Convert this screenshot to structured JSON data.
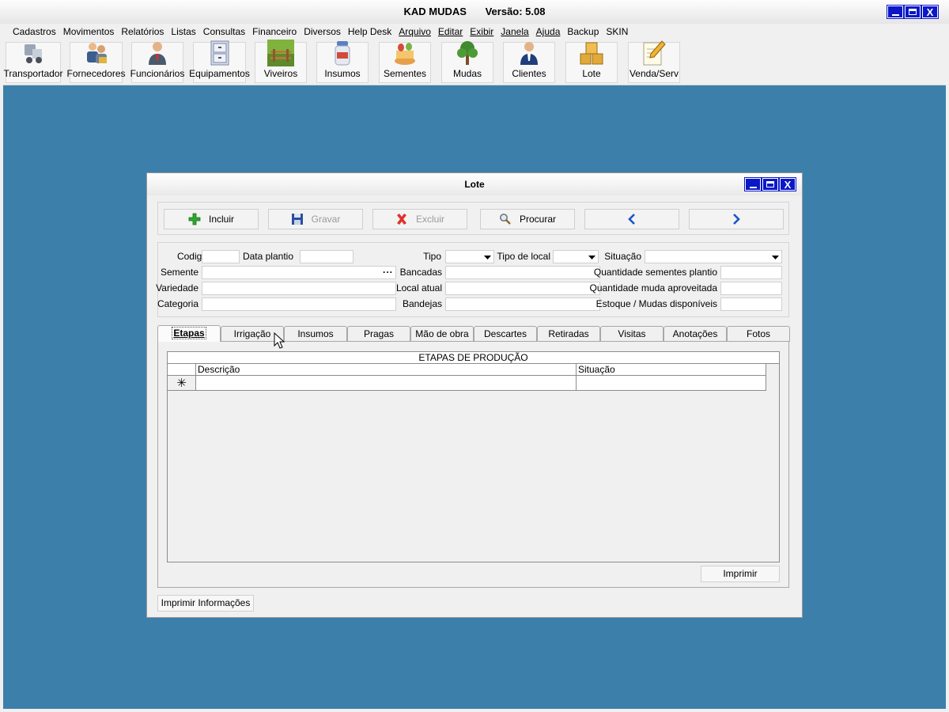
{
  "app": {
    "title": "KAD MUDAS",
    "version": "Versão: 5.08",
    "window_buttons": {
      "minimize": "minimize",
      "maximize": "maximize",
      "close": "X"
    }
  },
  "menu": [
    {
      "label": "Cadastros",
      "underline": false
    },
    {
      "label": "Movimentos",
      "underline": false
    },
    {
      "label": "Relatórios",
      "underline": false
    },
    {
      "label": "Listas",
      "underline": false
    },
    {
      "label": "Consultas",
      "underline": false
    },
    {
      "label": "Financeiro",
      "underline": false
    },
    {
      "label": "Diversos",
      "underline": false
    },
    {
      "label": "Help Desk",
      "underline": false
    },
    {
      "label": "Arquivo",
      "underline": true
    },
    {
      "label": "Editar",
      "underline": true
    },
    {
      "label": "Exibir",
      "underline": true
    },
    {
      "label": "Janela",
      "underline": true
    },
    {
      "label": "Ajuda",
      "underline": true
    },
    {
      "label": "Backup",
      "underline": false
    },
    {
      "label": "SKIN",
      "underline": false
    }
  ],
  "toolbar": [
    {
      "label": "Transportador",
      "icon": "truck-icon"
    },
    {
      "label": "Fornecedores",
      "icon": "suppliers-icon"
    },
    {
      "label": "Funcionários",
      "icon": "employee-icon"
    },
    {
      "label": "Equipamentos",
      "icon": "cabinet-icon"
    },
    {
      "label": "Viveiros",
      "icon": "nursery-icon"
    },
    {
      "label": "Insumos",
      "icon": "jar-icon"
    },
    {
      "label": "Sementes",
      "icon": "seeds-icon"
    },
    {
      "label": "Mudas",
      "icon": "tree-icon"
    },
    {
      "label": "Clientes",
      "icon": "client-icon"
    },
    {
      "label": "Lote",
      "icon": "boxes-icon"
    },
    {
      "label": "Venda/Serv",
      "icon": "pencil-note-icon"
    }
  ],
  "lote": {
    "title": "Lote",
    "actions": {
      "incluir": "Incluir",
      "gravar": "Gravar",
      "excluir": "Excluir",
      "procurar": "Procurar"
    },
    "form": {
      "codigo": {
        "label": "Codigo",
        "value": ""
      },
      "data_plantio": {
        "label": "Data plantio",
        "value": ""
      },
      "tipo": {
        "label": "Tipo",
        "value": ""
      },
      "tipo_local": {
        "label": "Tipo de local",
        "value": ""
      },
      "situacao": {
        "label": "Situação",
        "value": ""
      },
      "semente": {
        "label": "Semente",
        "value": "",
        "browse": "..."
      },
      "bancadas": {
        "label": "Bancadas",
        "value": ""
      },
      "qtd_sementes": {
        "label": "Quantidade sementes plantio",
        "value": ""
      },
      "variedade": {
        "label": "Variedade",
        "value": ""
      },
      "local_atual": {
        "label": "Local atual",
        "value": ""
      },
      "qtd_muda": {
        "label": "Quantidade muda aproveitada",
        "value": ""
      },
      "categoria": {
        "label": "Categoria",
        "value": ""
      },
      "bandejas": {
        "label": "Bandejas",
        "value": ""
      },
      "estoque": {
        "label": "Estoque / Mudas disponíveis",
        "value": ""
      }
    },
    "tabs": [
      "Etapas",
      "Irrigação",
      "Insumos",
      "Pragas",
      "Mão de obra",
      "Descartes",
      "Retiradas",
      "Visitas",
      "Anotações",
      "Fotos"
    ],
    "active_tab": "Etapas",
    "grid": {
      "caption": "ETAPAS DE PRODUÇÃO",
      "columns": [
        "Descrição",
        "Situação"
      ],
      "new_row_marker": "✳",
      "rows": []
    },
    "print_button": "Imprimir",
    "print_info_button": "Imprimir Informações"
  },
  "colors": {
    "desktop": "#3c7fab",
    "window_button": "#0a18c8",
    "chrome": "#f0f0f0"
  }
}
